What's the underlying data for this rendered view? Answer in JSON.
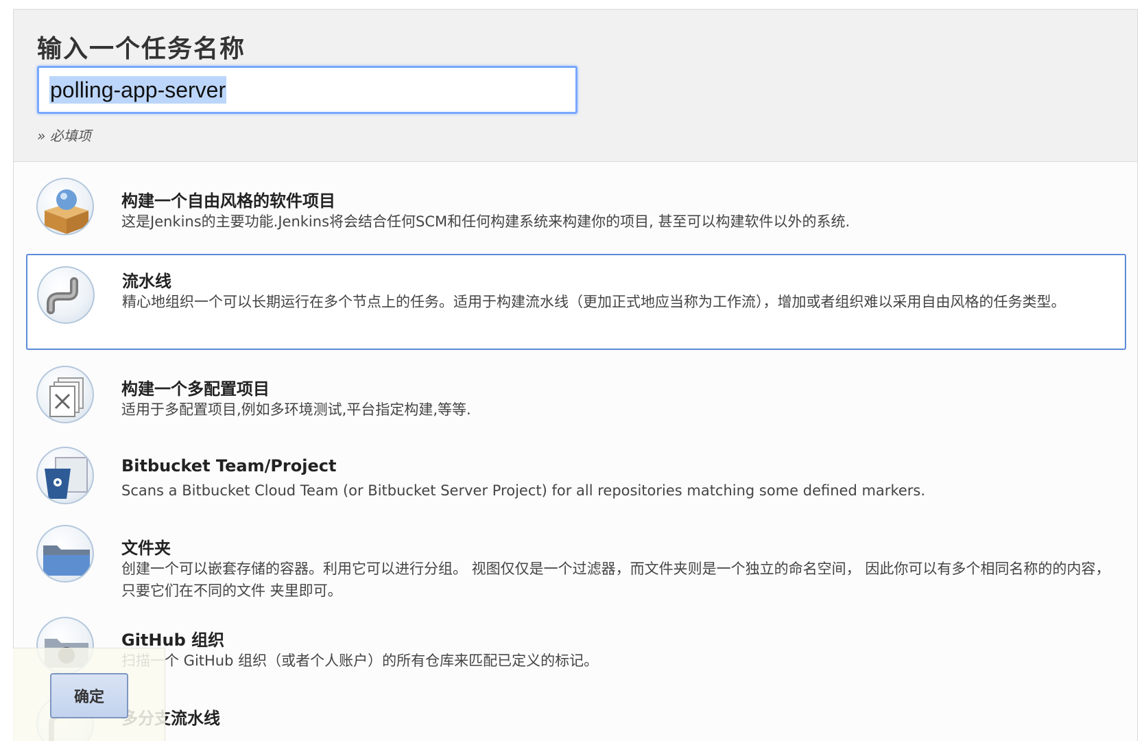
{
  "header": {
    "title": "输入一个任务名称",
    "name_value": "polling-app-server",
    "required_hint": "» 必填项"
  },
  "items": [
    {
      "icon": "freestyle-project-icon",
      "title": "构建一个自由风格的软件项目",
      "desc": "这是Jenkins的主要功能.Jenkins将会结合任何SCM和任何构建系统来构建你的项目, 甚至可以构建软件以外的系统."
    },
    {
      "icon": "pipeline-icon",
      "title": "流水线",
      "desc": "精心地组织一个可以长期运行在多个节点上的任务。适用于构建流水线（更加正式地应当称为工作流），增加或者组织难以采用自由风格的任务类型。"
    },
    {
      "icon": "multi-config-project-icon",
      "title": "构建一个多配置项目",
      "desc": "适用于多配置项目,例如多环境测试,平台指定构建,等等."
    },
    {
      "icon": "bitbucket-icon",
      "title": "Bitbucket Team/Project",
      "desc": "Scans a Bitbucket Cloud Team (or Bitbucket Server Project) for all repositories matching some defined markers."
    },
    {
      "icon": "folder-icon",
      "title": "文件夹",
      "desc": "创建一个可以嵌套存储的容器。利用它可以进行分组。 视图仅仅是一个过滤器，而文件夹则是一个独立的命名空间， 因此你可以有多个相同名称的的内容，只要它们在不同的文件 夹里即可。"
    },
    {
      "icon": "github-org-icon",
      "title": "GitHub 组织",
      "desc": "扫描一个 GitHub 组织（或者个人账户）的所有仓库来匹配已定义的标记。"
    },
    {
      "icon": "multibranch-pipeline-icon",
      "title": "多分支流水线",
      "desc": ""
    }
  ],
  "footer": {
    "ok_label": "确定"
  },
  "colors": {
    "selected_border": "#5b8ad8",
    "input_focus": "#79a8ff",
    "header_bg": "#f1f1f1"
  }
}
